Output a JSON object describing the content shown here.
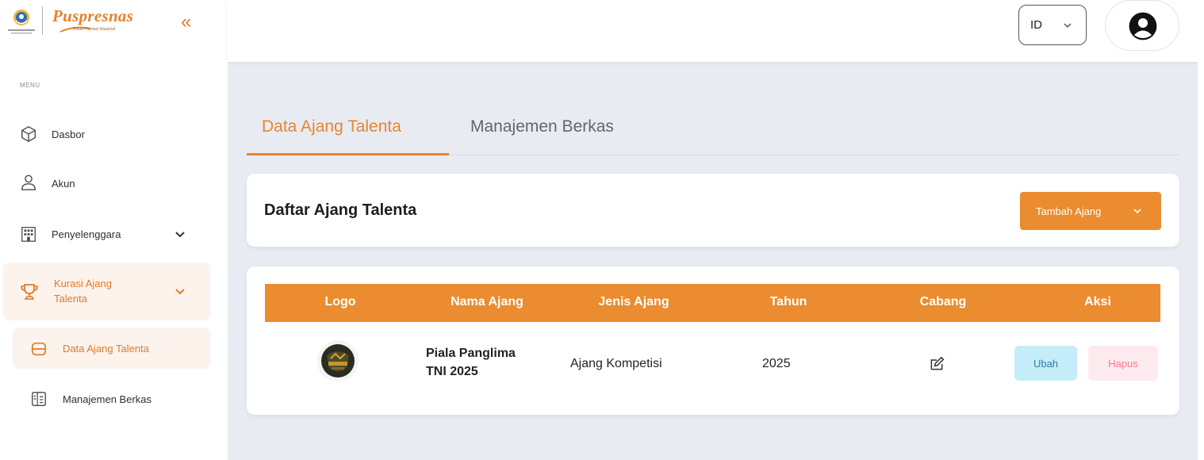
{
  "sidebar": {
    "brand": "Puspresnas",
    "brand_sub": "Pusat Prestasi Nasional",
    "collapse_icon": "«",
    "menu_label": "MENU",
    "items": [
      {
        "label": "Dasbor",
        "icon": "cube-icon"
      },
      {
        "label": "Akun",
        "icon": "user-icon"
      },
      {
        "label": "Penyelenggara",
        "icon": "building-icon"
      },
      {
        "label": "Kurasi Ajang Talenta",
        "label_line1": "Kurasi Ajang",
        "label_line2": "Talenta",
        "icon": "trophy-icon"
      }
    ],
    "subitems": [
      {
        "label": "Data Ajang Talenta",
        "icon": "database-icon"
      },
      {
        "label": "Manajemen Berkas",
        "icon": "files-icon"
      }
    ]
  },
  "header": {
    "language": "ID"
  },
  "tabs": [
    {
      "label": "Data Ajang Talenta",
      "active": true
    },
    {
      "label": "Manajemen Berkas",
      "active": false
    }
  ],
  "list_card": {
    "title": "Daftar Ajang Talenta",
    "add_button": "Tambah Ajang"
  },
  "table": {
    "columns": [
      "Logo",
      "Nama Ajang",
      "Jenis Ajang",
      "Tahun",
      "Cabang",
      "Aksi"
    ],
    "rows": [
      {
        "name_line1": "Piala Panglima",
        "name_line2": "TNI 2025",
        "type": "Ajang Kompetisi",
        "year": "2025",
        "edit_button": "Ubah",
        "delete_button": "Hapus"
      }
    ]
  },
  "colors": {
    "accent": "#ea8c2f",
    "tab_active": "#e6862d",
    "background": "#e9ebf3",
    "ubah_bg": "#c4ecf9",
    "hapus_bg": "#fdeaee"
  }
}
